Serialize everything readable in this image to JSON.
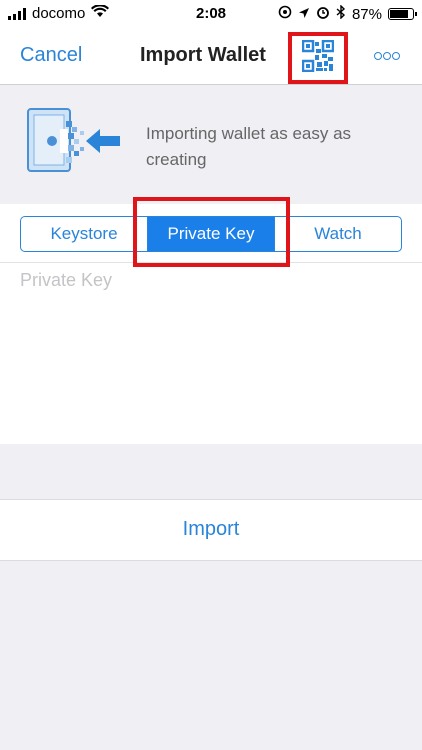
{
  "status": {
    "carrier": "docomo",
    "time": "2:08",
    "battery": "87%",
    "battery_level": 0.87
  },
  "nav": {
    "cancel": "Cancel",
    "title": "Import Wallet"
  },
  "banner": {
    "text": "Importing wallet as easy as creating"
  },
  "segments": [
    "Keystore",
    "Private Key",
    "Watch"
  ],
  "active_segment": 1,
  "input": {
    "placeholder": "Private Key",
    "value": ""
  },
  "import_button": "Import",
  "colors": {
    "accent": "#2a84d8",
    "active_segment": "#1a7fe8",
    "highlight": "#e0151a"
  },
  "icons": [
    "wifi-icon",
    "location-icon",
    "alarm-icon",
    "bluetooth-icon",
    "qr-code-icon",
    "more-icon",
    "wallet-import-icon"
  ]
}
